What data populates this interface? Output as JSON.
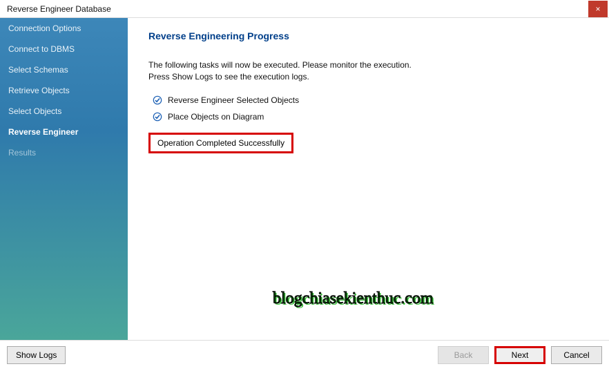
{
  "title": "Reverse Engineer Database",
  "close_icon": "×",
  "sidebar": {
    "items": [
      {
        "label": "Connection Options"
      },
      {
        "label": "Connect to DBMS"
      },
      {
        "label": "Select Schemas"
      },
      {
        "label": "Retrieve Objects"
      },
      {
        "label": "Select Objects"
      },
      {
        "label": "Reverse Engineer",
        "active": true
      },
      {
        "label": "Results",
        "dim": true
      }
    ]
  },
  "main": {
    "heading": "Reverse Engineering Progress",
    "info_line1": "The following tasks will now be executed. Please monitor the execution.",
    "info_line2": "Press Show Logs to see the execution logs.",
    "tasks": [
      {
        "label": "Reverse Engineer Selected Objects"
      },
      {
        "label": "Place Objects on Diagram"
      }
    ],
    "status": "Operation Completed Successfully"
  },
  "footer": {
    "show_logs": "Show Logs",
    "back": "Back",
    "next": "Next",
    "cancel": "Cancel"
  },
  "watermark": "blogchiasekienthuc.com"
}
